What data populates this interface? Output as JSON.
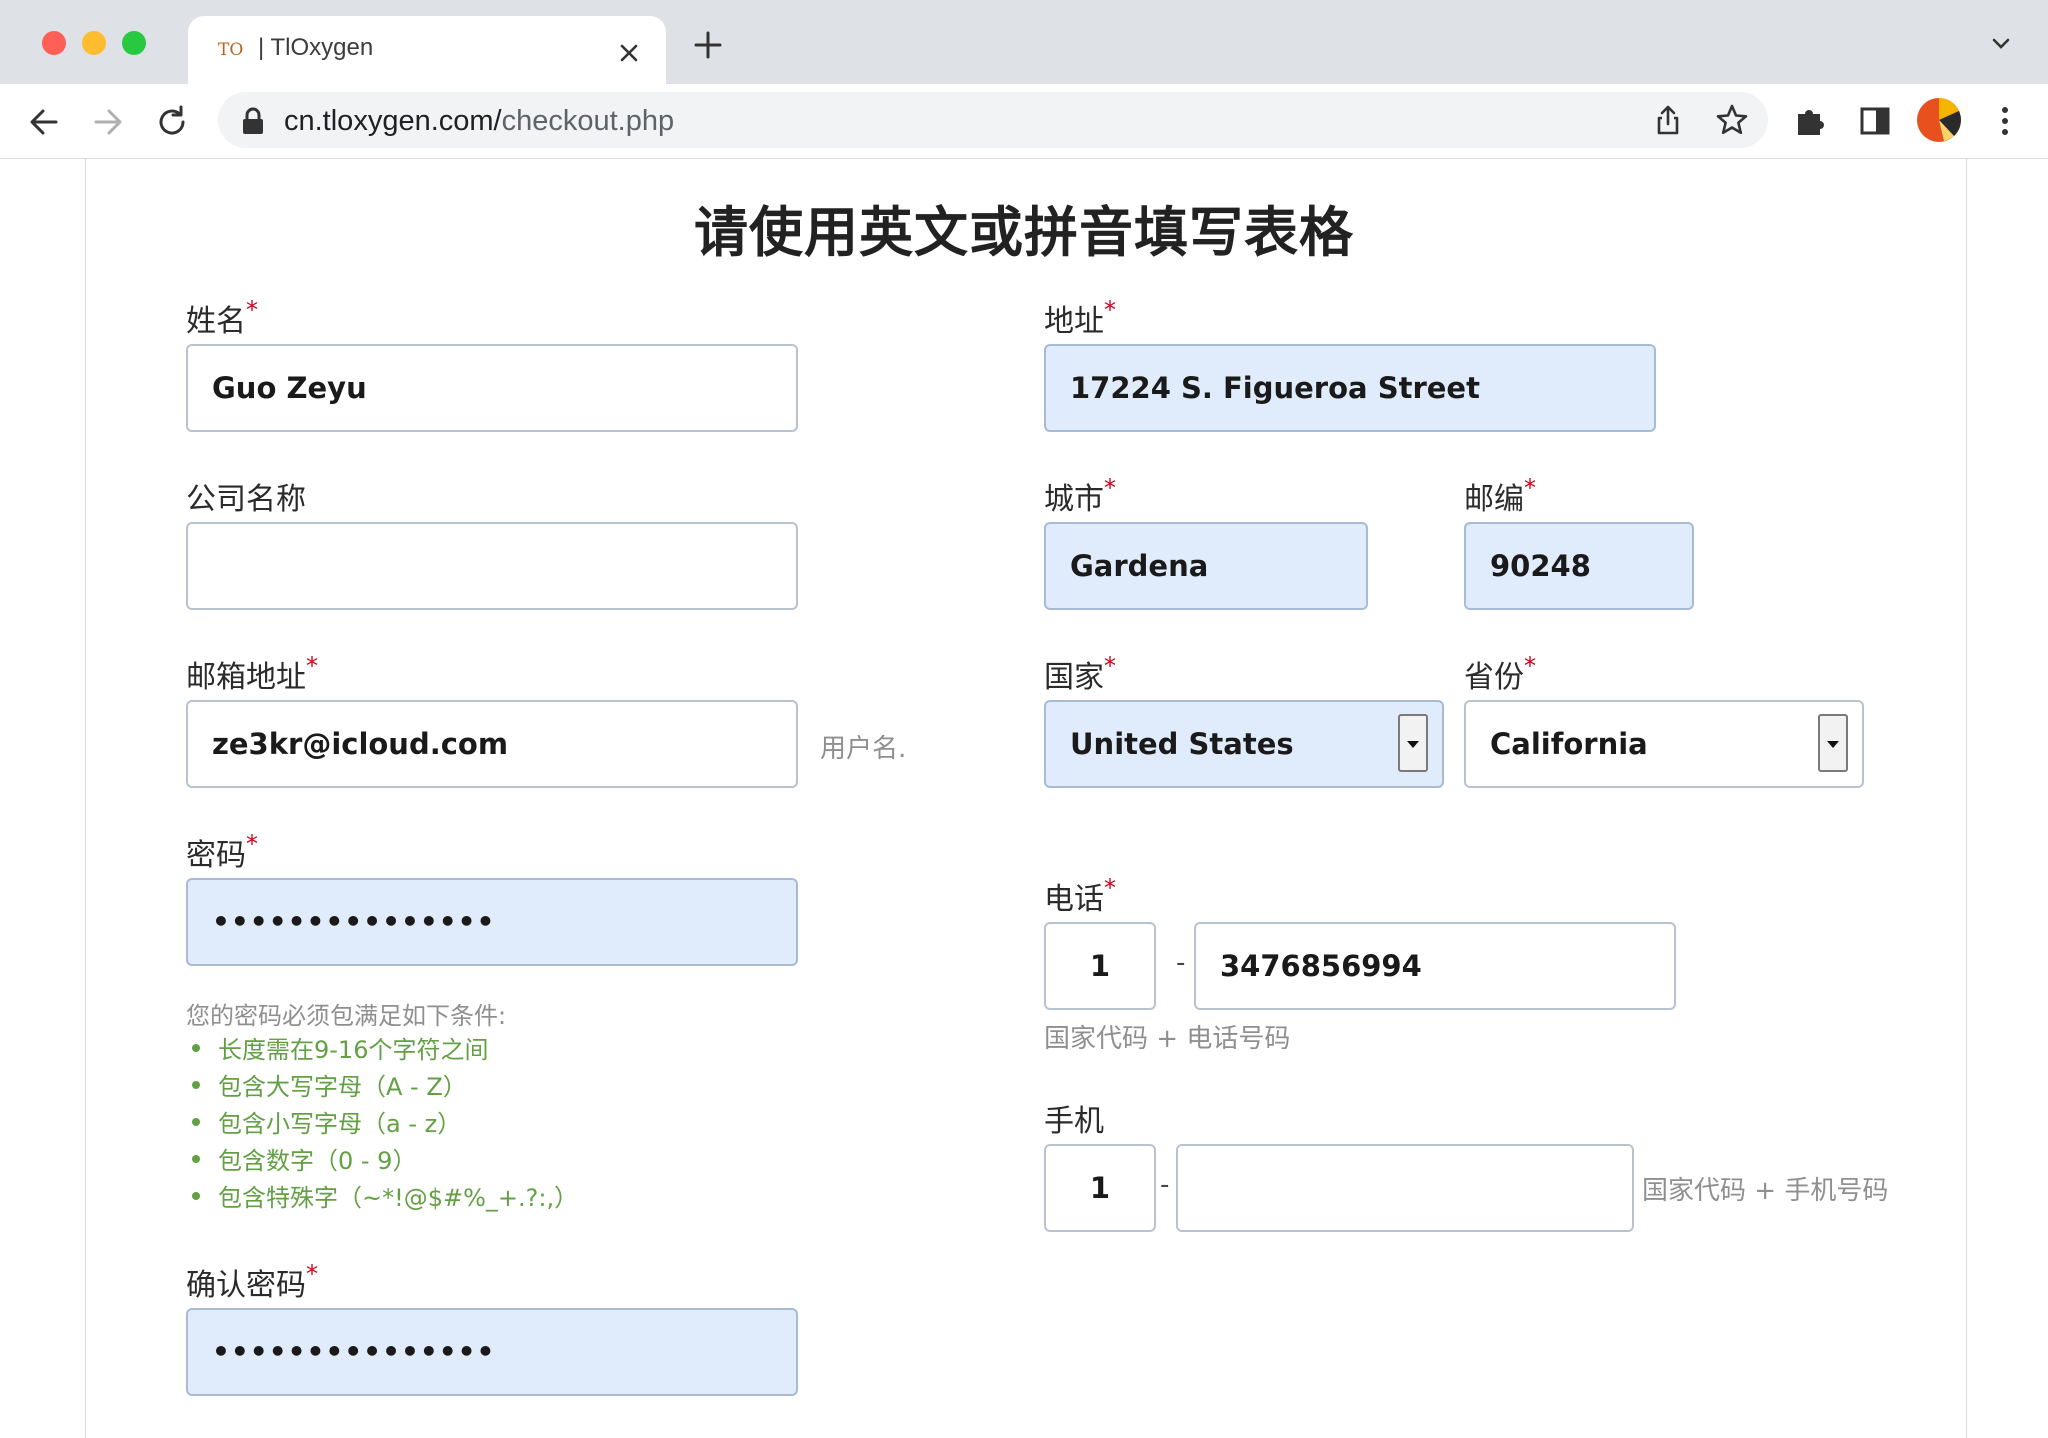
{
  "browser": {
    "tab": {
      "favicon_text": "TO",
      "title": "| TlOxygen"
    },
    "url": {
      "host": "cn.tloxygen.com/",
      "path": "checkout.php"
    }
  },
  "page": {
    "heading": "请使用英文或拼音填写表格"
  },
  "form": {
    "required_marker": "*",
    "name": {
      "label": "姓名",
      "value": "Guo Zeyu"
    },
    "company": {
      "label": "公司名称",
      "value": ""
    },
    "email": {
      "label": "邮箱地址",
      "value": "ze3kr@icloud.com",
      "hint": "用户名."
    },
    "password": {
      "label": "密码",
      "value": "•••••••••••••••"
    },
    "password_rules": {
      "title": "您的密码必须包满足如下条件:",
      "items": [
        "长度需在9-16个字符之间",
        "包含大写字母（A - Z）",
        "包含小写字母（a - z）",
        "包含数字（0 - 9）",
        "包含特殊字（~*!@$#%_+.?:,）"
      ]
    },
    "confirm_password": {
      "label": "确认密码",
      "value": "•••••••••••••••"
    },
    "address": {
      "label": "地址",
      "value": "17224 S. Figueroa Street"
    },
    "city": {
      "label": "城市",
      "value": "Gardena"
    },
    "zip": {
      "label": "邮编",
      "value": "90248"
    },
    "country": {
      "label": "国家",
      "value": "United States"
    },
    "state": {
      "label": "省份",
      "value": "California"
    },
    "phone": {
      "label": "电话",
      "country_code": "1",
      "separator": "-",
      "number": "3476856994",
      "hint": "国家代码 + 电话号码"
    },
    "mobile": {
      "label": "手机",
      "country_code": "1",
      "separator": "-",
      "number": "",
      "hint": "国家代码 + 手机号码"
    }
  },
  "colors": {
    "required": "#d0021b",
    "filled_bg": "#e0ebfc",
    "rule_green": "#63a044"
  }
}
